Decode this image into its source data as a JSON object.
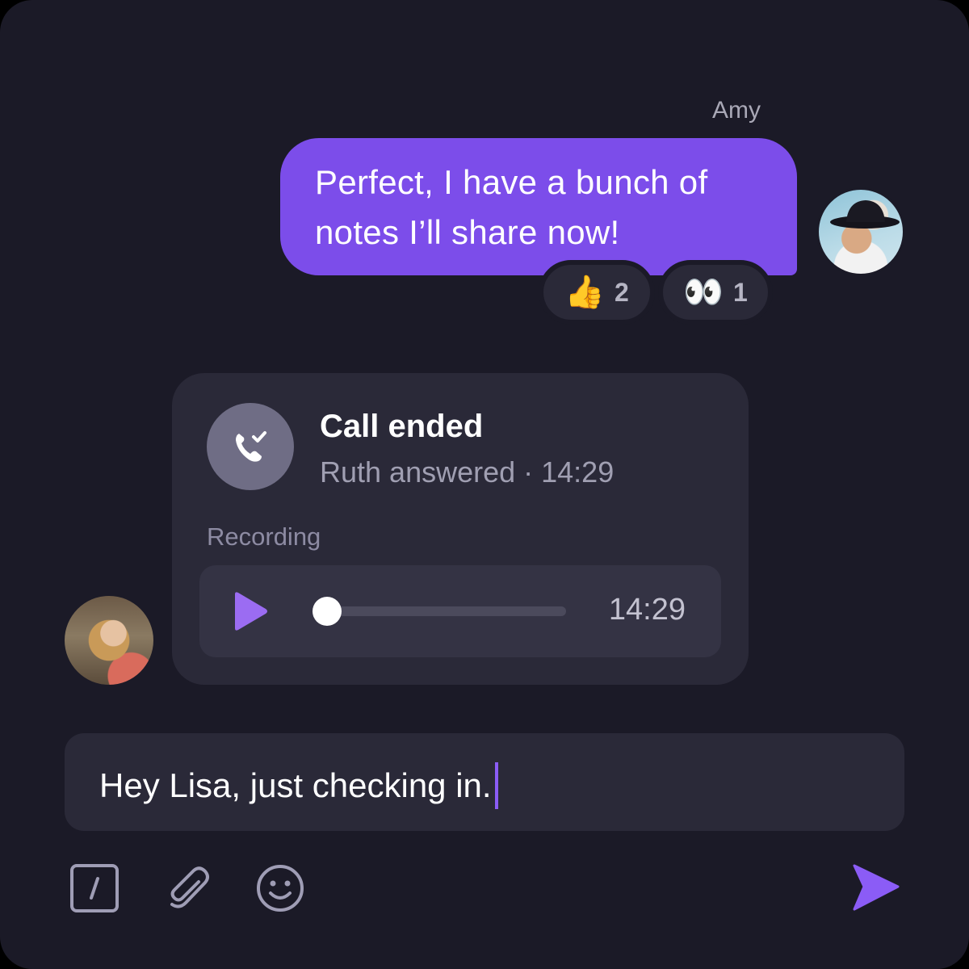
{
  "message": {
    "sender": "Amy",
    "text_line1": "Perfect, I have a bunch of",
    "text_line2": "notes I’ll share now!",
    "reactions": [
      {
        "emoji": "👍",
        "count": "2"
      },
      {
        "emoji": "👀",
        "count": "1"
      }
    ]
  },
  "call": {
    "title": "Call ended",
    "subtitle": "Ruth answered · 14:29",
    "recording_label": "Recording",
    "duration": "14:29",
    "progress": 0.0
  },
  "composer": {
    "value": "Hey Lisa, just checking in."
  },
  "icons": {
    "commands": "slash-command-icon",
    "attach": "paperclip-icon",
    "emoji": "smiley-icon",
    "send": "send-arrow-icon",
    "play": "play-icon",
    "call": "phone-check-icon"
  },
  "colors": {
    "background": "#1b1a27",
    "accent": "#7c4dea",
    "card": "#2a2938"
  }
}
